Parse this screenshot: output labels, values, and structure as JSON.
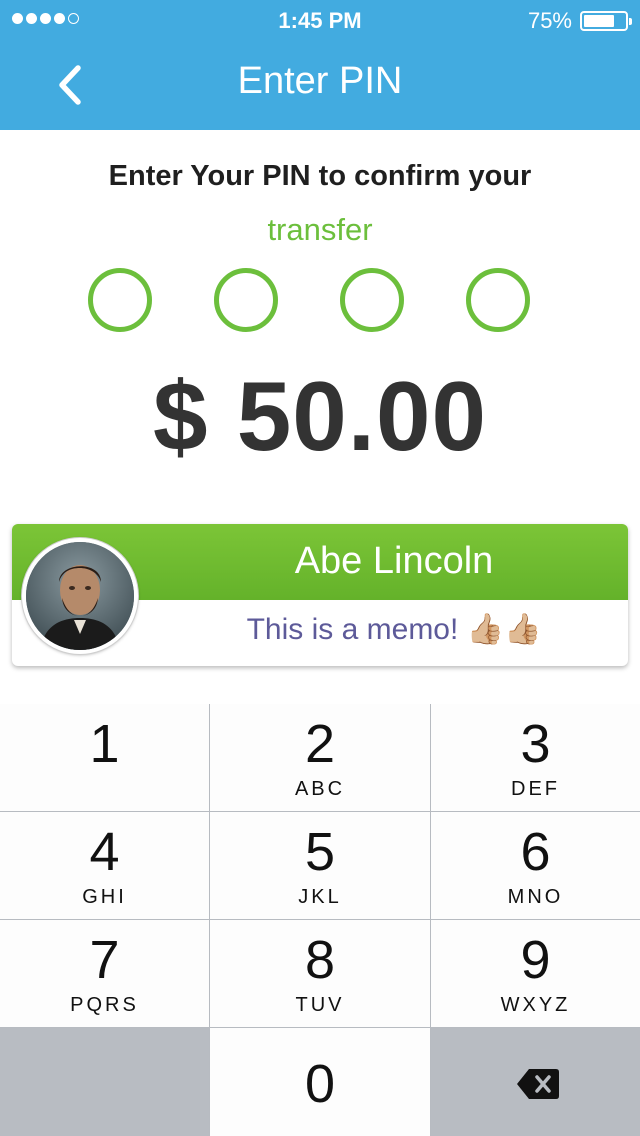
{
  "status_bar": {
    "time": "1:45 PM",
    "battery_percent": "75%",
    "battery_level": 0.75,
    "signal_bars_filled": 4,
    "signal_bars_total": 5
  },
  "nav": {
    "title": "Enter PIN",
    "back_icon": "chevron-left-icon"
  },
  "prompt": {
    "line1": "Enter Your PIN to confirm your",
    "line2": "transfer"
  },
  "pin": {
    "length": 4,
    "entered": 0
  },
  "amount": "$ 50.00",
  "recipient": {
    "name": "Abe Lincoln",
    "memo": "This is a memo! 👍🏼👍🏼"
  },
  "keypad": {
    "keys": [
      {
        "digit": "1",
        "letters": ""
      },
      {
        "digit": "2",
        "letters": "ABC"
      },
      {
        "digit": "3",
        "letters": "DEF"
      },
      {
        "digit": "4",
        "letters": "GHI"
      },
      {
        "digit": "5",
        "letters": "JKL"
      },
      {
        "digit": "6",
        "letters": "MNO"
      },
      {
        "digit": "7",
        "letters": "PQRS"
      },
      {
        "digit": "8",
        "letters": "TUV"
      },
      {
        "digit": "9",
        "letters": "WXYZ"
      },
      {
        "digit": "0",
        "letters": ""
      }
    ],
    "delete_icon": "backspace-icon"
  },
  "colors": {
    "header": "#42abe0",
    "accent_green": "#6cbf3c",
    "memo_text": "#5d5a99",
    "amount_text": "#333333"
  }
}
